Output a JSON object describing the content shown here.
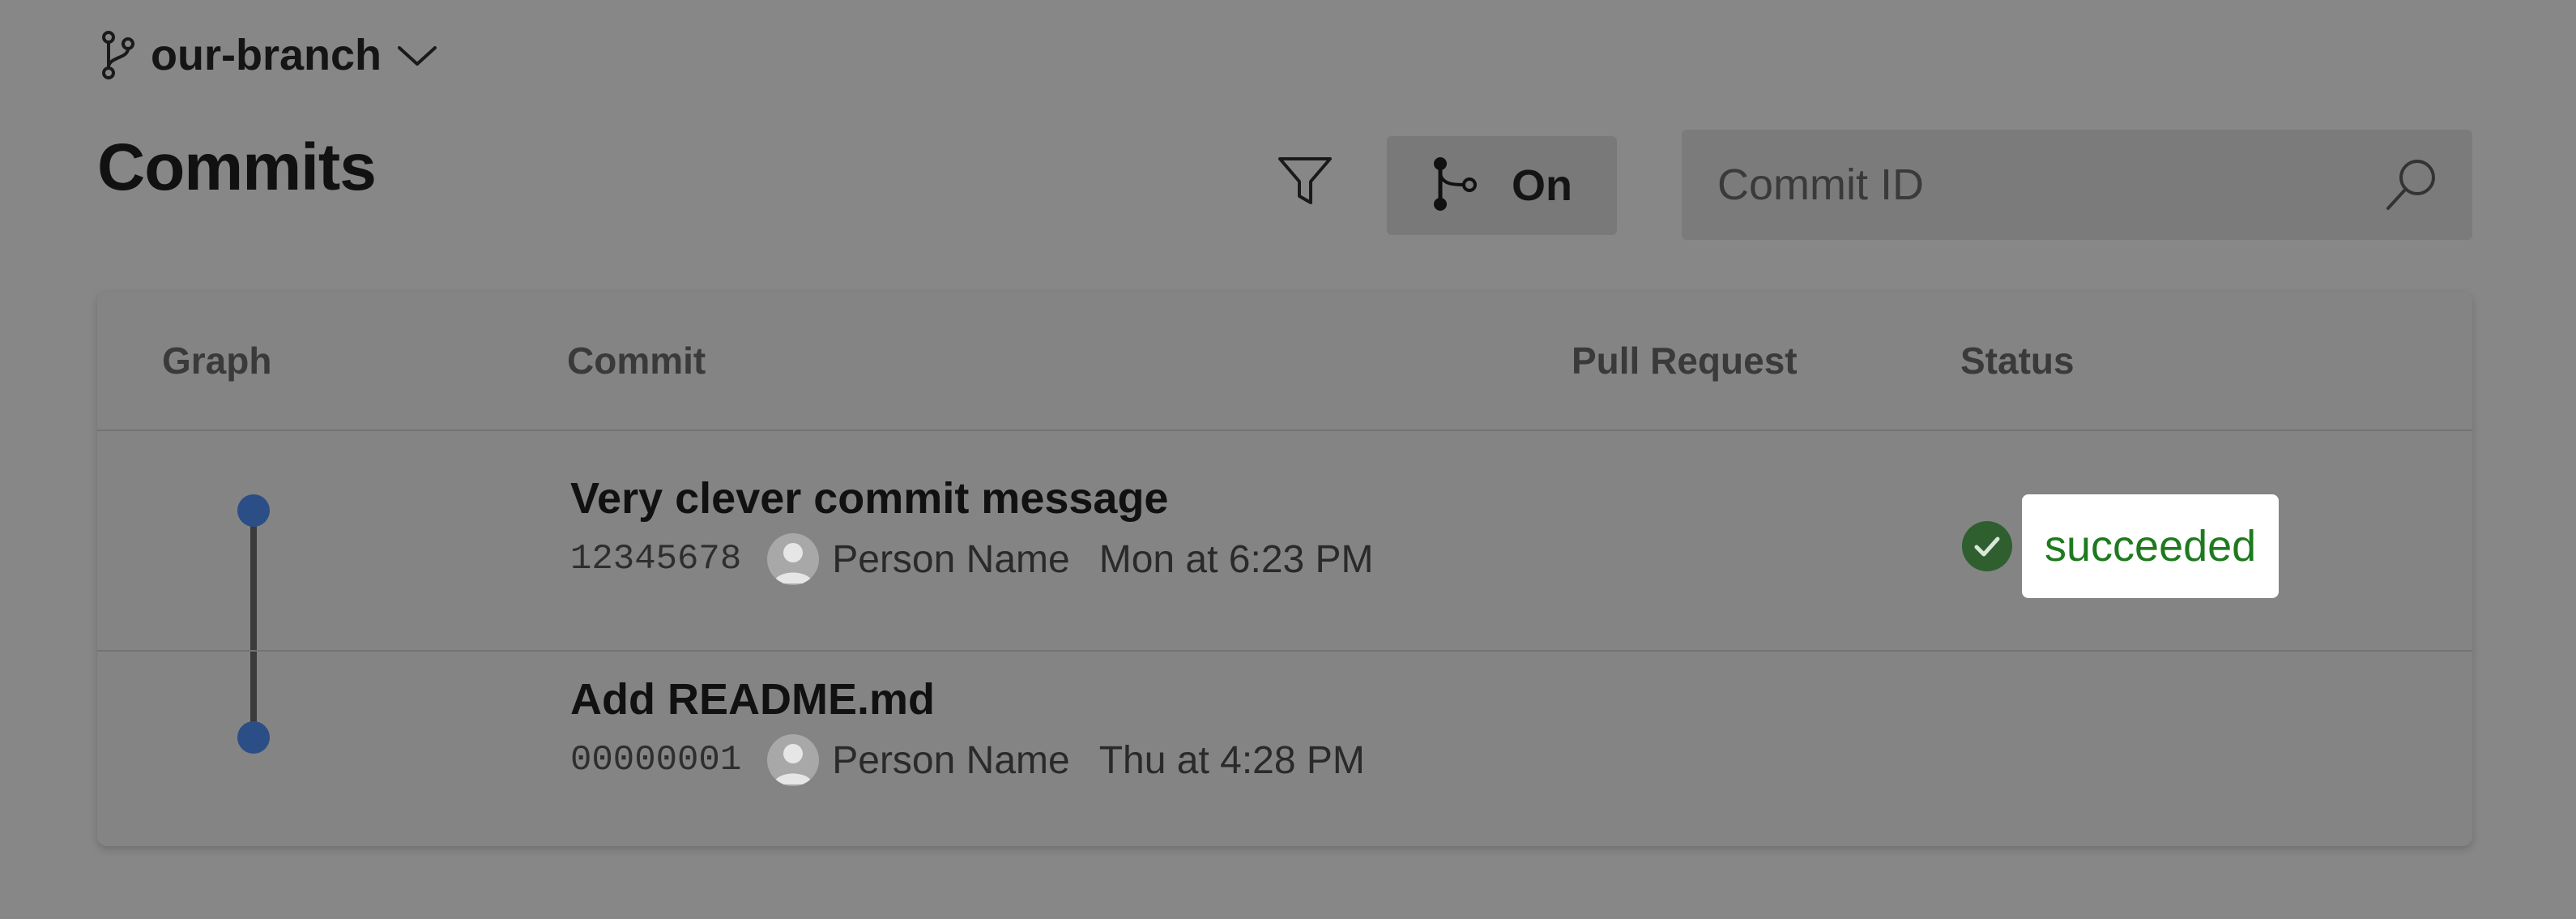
{
  "branch": {
    "name": "our-branch",
    "branch_icon": "git-branch-icon",
    "dropdown_icon": "chevron-down-icon"
  },
  "page": {
    "title": "Commits"
  },
  "toolbar": {
    "filter_icon": "filter-icon",
    "graph_toggle_icon": "git-graph-icon",
    "graph_toggle_label": "On",
    "search_placeholder": "Commit ID",
    "search_value": "",
    "search_icon": "search-icon"
  },
  "table": {
    "columns": [
      "Graph",
      "Commit",
      "Pull Request",
      "Status"
    ],
    "rows": [
      {
        "message": "Very clever commit message",
        "commit_id": "12345678",
        "author": "Person Name",
        "date": "Mon at 6:23 PM",
        "pull_request": "",
        "status": "succeeded",
        "status_icon": "check-circle-icon"
      },
      {
        "message": "Add README.md",
        "commit_id": "00000001",
        "author": "Person Name",
        "date": "Thu at 4:28 PM",
        "pull_request": "",
        "status": "",
        "status_icon": ""
      }
    ]
  },
  "colors": {
    "graph_node": "#2b4e86",
    "graph_line": "#3b3b3b",
    "status_success": "#1f7a1f",
    "status_check_bg": "#2f5e2f",
    "overlay_bg": "#878787"
  }
}
